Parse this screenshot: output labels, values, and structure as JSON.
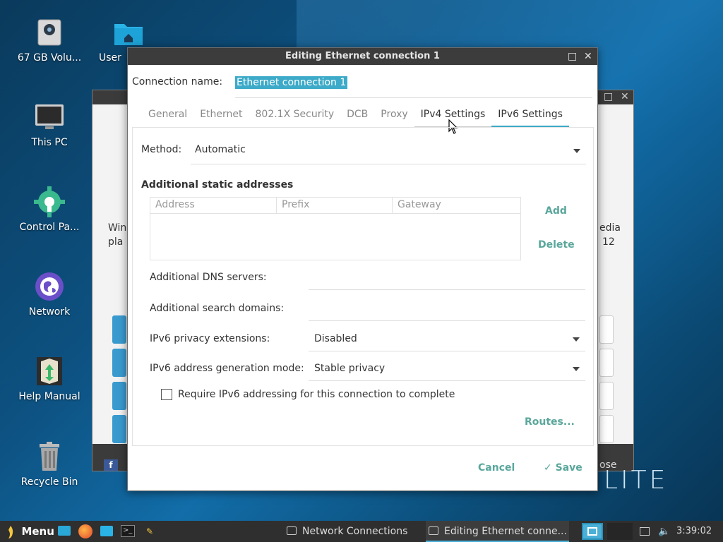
{
  "desktop": {
    "icons": [
      {
        "label": "67 GB Volu...",
        "icon": "drive-icon"
      },
      {
        "label": "User",
        "icon": "home-folder-icon"
      },
      {
        "label": "This PC",
        "icon": "monitor-icon"
      },
      {
        "label": "Control Pa...",
        "icon": "gear-icon"
      },
      {
        "label": "Network",
        "icon": "globe-icon"
      },
      {
        "label": "Help Manual",
        "icon": "help-manual-icon"
      },
      {
        "label": "Recycle Bin",
        "icon": "trash-icon"
      }
    ],
    "branding": "LITE"
  },
  "background_window": {
    "text_left": [
      "Win",
      "pla"
    ],
    "text_right": [
      "edia",
      "12"
    ],
    "footer_text": "ose"
  },
  "dialog": {
    "title": "Editing Ethernet connection 1",
    "maximize_icon": "maximize-icon",
    "close_icon": "close-icon",
    "connection_name_label": "Connection name:",
    "connection_name_value": "Ethernet connection 1",
    "tabs": [
      {
        "label": "General"
      },
      {
        "label": "Ethernet"
      },
      {
        "label": "802.1X Security"
      },
      {
        "label": "DCB"
      },
      {
        "label": "Proxy"
      },
      {
        "label": "IPv4 Settings"
      },
      {
        "label": "IPv6 Settings"
      }
    ],
    "active_tab": "IPv6 Settings",
    "method_label": "Method:",
    "method_value": "Automatic",
    "static_addresses_heading": "Additional static addresses",
    "table_headers": [
      "Address",
      "Prefix",
      "Gateway"
    ],
    "add_label": "Add",
    "delete_label": "Delete",
    "dns_label": "Additional DNS servers:",
    "search_domains_label": "Additional search domains:",
    "privacy_label": "IPv6 privacy extensions:",
    "privacy_value": "Disabled",
    "addr_gen_label": "IPv6 address generation mode:",
    "addr_gen_value": "Stable privacy",
    "require_label": "Require IPv6 addressing for this connection to complete",
    "require_checked": false,
    "routes_label": "Routes...",
    "cancel_label": "Cancel",
    "save_label": "Save",
    "accent_color": "#3caac8",
    "button_color": "#5aa79b"
  },
  "taskbar": {
    "menu_label": "Menu",
    "tasks": [
      {
        "label": "Network Connections",
        "active": false
      },
      {
        "label": "Editing Ethernet conne...",
        "active": true
      }
    ],
    "clock": "3:39:02 pm"
  }
}
